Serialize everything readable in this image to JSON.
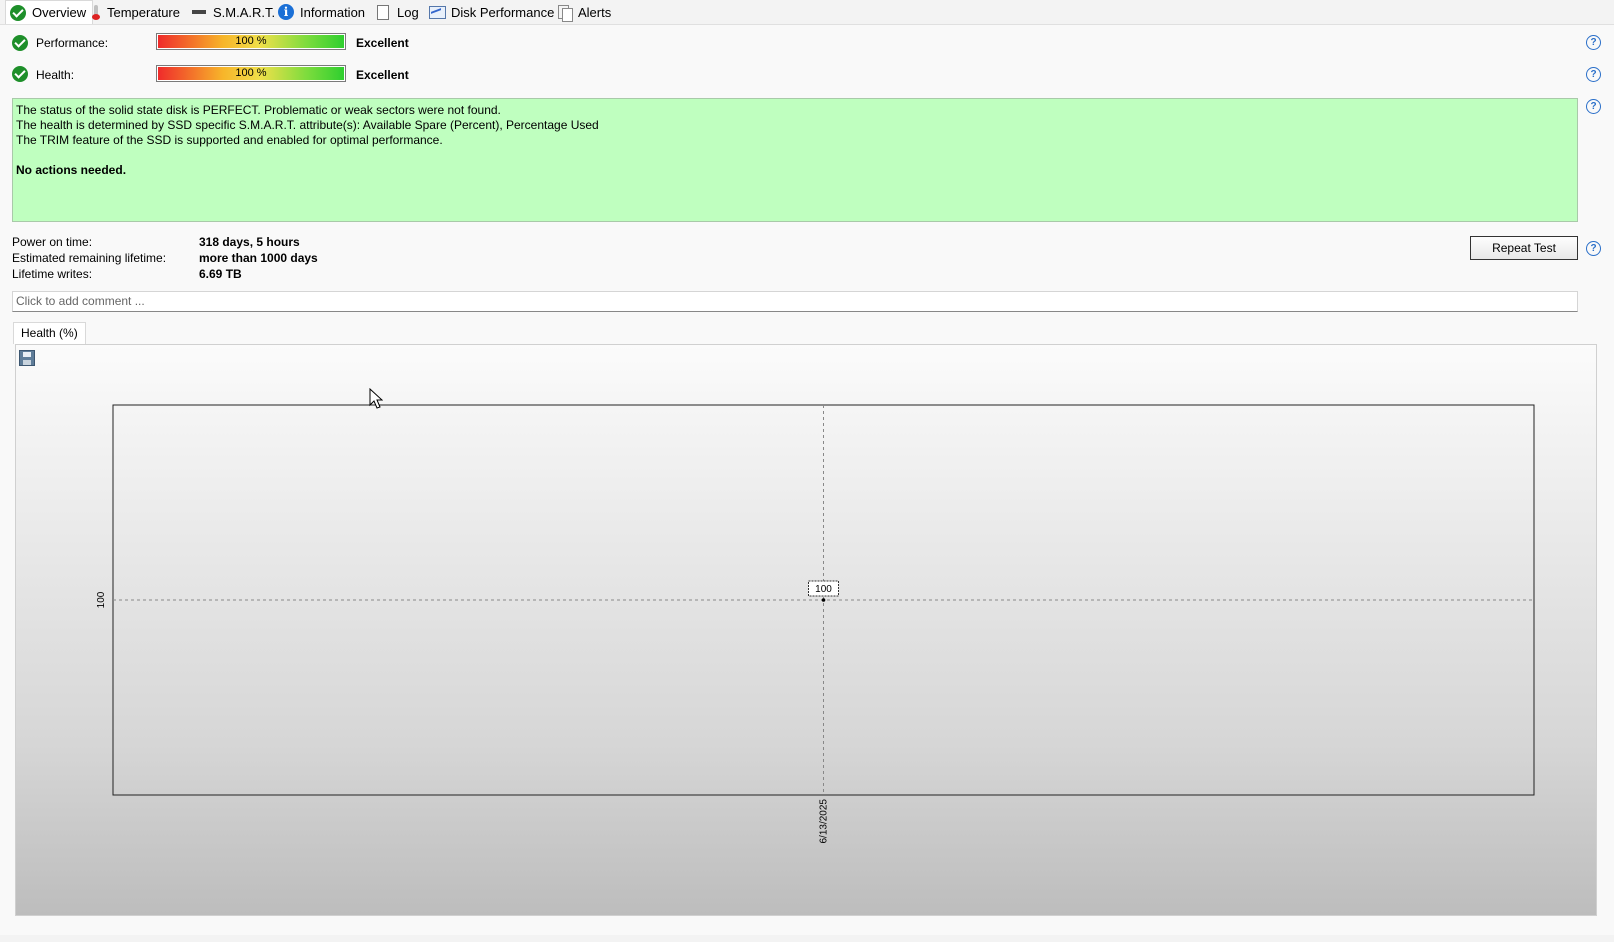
{
  "tabs": [
    {
      "label": "Overview",
      "icon": "check-icon",
      "active": true
    },
    {
      "label": "Temperature",
      "icon": "thermometer-icon"
    },
    {
      "label": "S.M.A.R.T.",
      "icon": "smart-icon"
    },
    {
      "label": "Information",
      "icon": "info-icon"
    },
    {
      "label": "Log",
      "icon": "document-icon"
    },
    {
      "label": "Disk Performance",
      "icon": "chart-icon"
    },
    {
      "label": "Alerts",
      "icon": "alerts-icon"
    }
  ],
  "performance": {
    "label": "Performance:",
    "value_text": "100 %",
    "fill": 1.0,
    "rating": "Excellent"
  },
  "health": {
    "label": "Health:",
    "value_text": "100 %",
    "fill": 1.0,
    "rating": "Excellent"
  },
  "message": {
    "lines": [
      "The status of the solid state disk is PERFECT. Problematic or weak sectors were not found.",
      "The health is determined by SSD specific S.M.A.R.T. attribute(s):  Available Spare (Percent), Percentage Used",
      "The TRIM feature of the SSD is supported and enabled for optimal performance."
    ],
    "action": "No actions needed.",
    "background": "#bfffbf"
  },
  "stats": {
    "power_on_label": "Power on time:",
    "power_on_value": "318 days, 5 hours",
    "remaining_label": "Estimated remaining lifetime:",
    "remaining_value": "more than 1000 days",
    "writes_label": "Lifetime writes:",
    "writes_value": "6.69 TB"
  },
  "repeat_button": "Repeat Test",
  "comment_placeholder": "Click to add comment ...",
  "chart_tab": "Health (%)",
  "chart_data": {
    "type": "line",
    "x": [
      "6/13/2025"
    ],
    "series": [
      {
        "values": [
          100
        ]
      }
    ],
    "y_tick_labels": [
      "100"
    ],
    "point_labels": [
      "100"
    ],
    "grid": false
  }
}
